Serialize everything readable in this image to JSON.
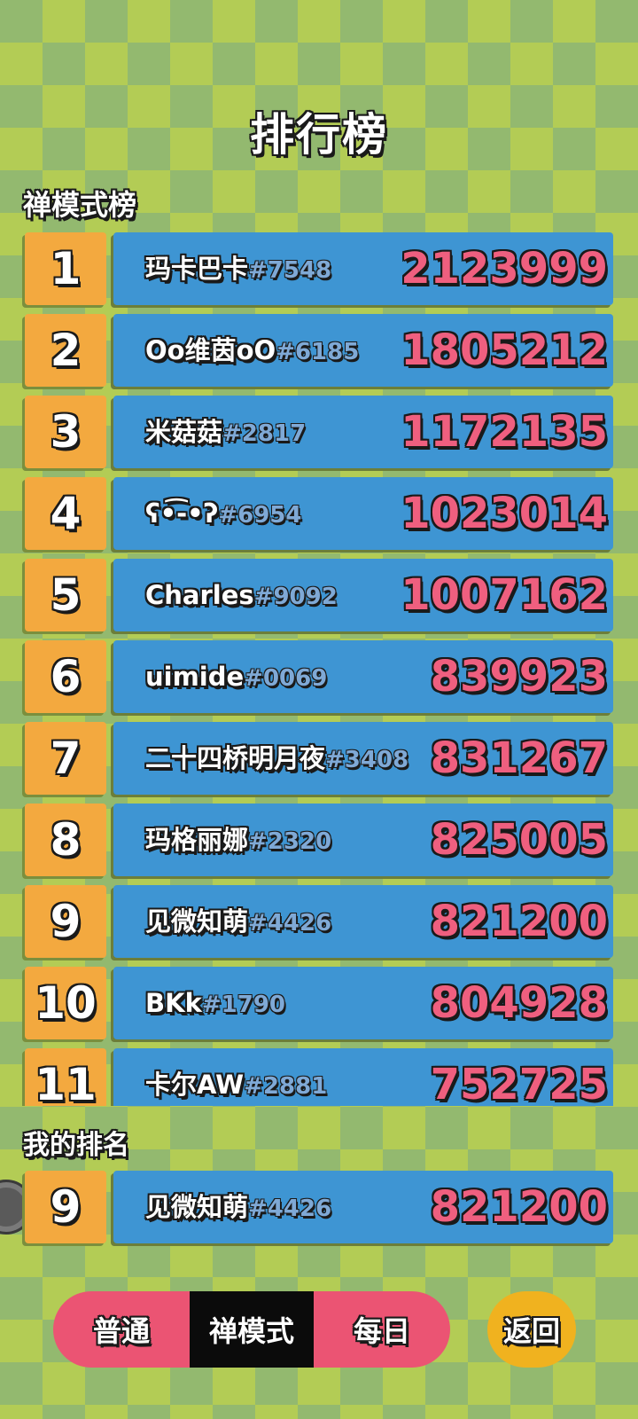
{
  "title": "排行榜",
  "board_label": "禅模式榜",
  "my_rank_label": "我的排名",
  "colors": {
    "rank_box": "#f3a93f",
    "name_bar": "#3e95d3",
    "score": "#ef5f7f",
    "tab_bg": "#eb5473",
    "tab_active": "#0b0b0b",
    "back_button": "#f0b21f"
  },
  "leaderboard": [
    {
      "rank": "1",
      "name": "玛卡巴卡",
      "tag": "#7548",
      "score": "2123999"
    },
    {
      "rank": "2",
      "name": "Oo维茵oO",
      "tag": "#6185",
      "score": "1805212"
    },
    {
      "rank": "3",
      "name": "米菇菇",
      "tag": "#2817",
      "score": "1172135"
    },
    {
      "rank": "4",
      "name": "ʕ•͡-•ʔ",
      "tag": "#6954",
      "score": "1023014"
    },
    {
      "rank": "5",
      "name": "Charles",
      "tag": "#9092",
      "score": "1007162"
    },
    {
      "rank": "6",
      "name": "uimide",
      "tag": "#0069",
      "score": "839923"
    },
    {
      "rank": "7",
      "name": "二十四桥明月夜",
      "tag": "#3408",
      "score": "831267"
    },
    {
      "rank": "8",
      "name": "玛格丽娜",
      "tag": "#2320",
      "score": "825005"
    },
    {
      "rank": "9",
      "name": "见微知萌",
      "tag": "#4426",
      "score": "821200"
    },
    {
      "rank": "10",
      "name": "BKk",
      "tag": "#1790",
      "score": "804928"
    },
    {
      "rank": "11",
      "name": "卡尔AW",
      "tag": "#2881",
      "score": "752725"
    }
  ],
  "my_rank": {
    "rank": "9",
    "name": "见微知萌",
    "tag": "#4426",
    "score": "821200"
  },
  "tabs": [
    {
      "label": "普通",
      "active": false
    },
    {
      "label": "禅模式",
      "active": true
    },
    {
      "label": "每日",
      "active": false
    }
  ],
  "back_label": "返回"
}
